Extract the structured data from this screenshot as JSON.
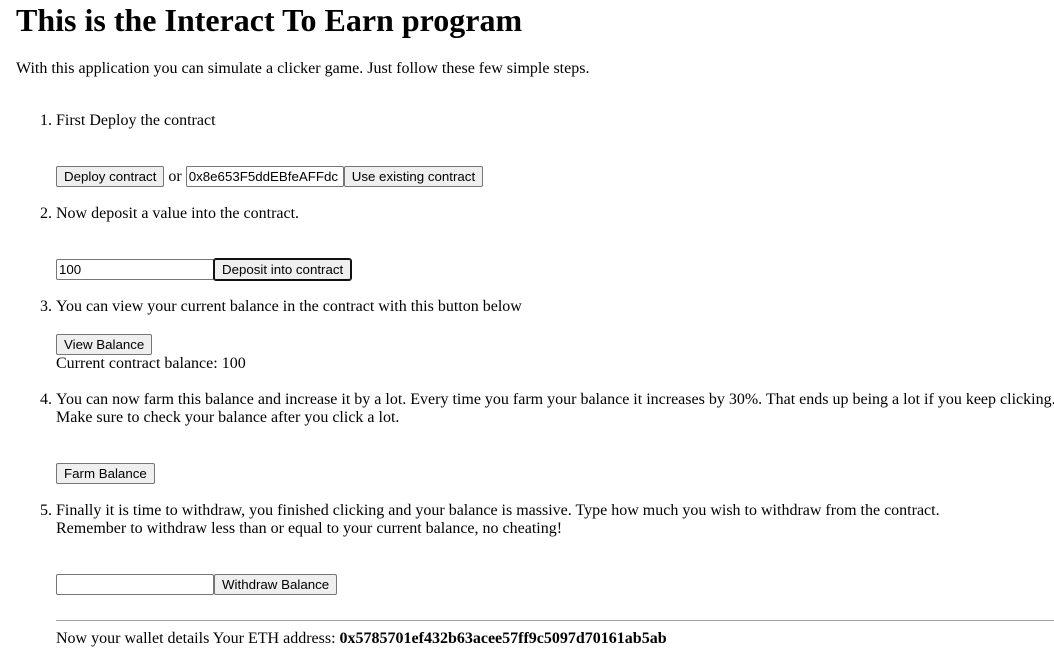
{
  "page": {
    "title": "This is the Interact To Earn program",
    "intro": "With this application you can simulate a clicker game. Just follow these few simple steps."
  },
  "steps": [
    {
      "number": "1.",
      "text": "First Deploy the contract"
    },
    {
      "number": "2.",
      "text": "Now deposit a value into the contract."
    },
    {
      "number": "3.",
      "text": "You can view your current balance in the contract with this button below"
    },
    {
      "number": "4.",
      "text": "You can now farm this balance and increase it by a lot. Every time you farm your balance it increases by 30%. That ends up being a lot if you keep clicking.",
      "text2": "Make sure to check your balance after you click a lot."
    },
    {
      "number": "5.",
      "text": "Finally it is time to withdraw, you finished clicking and your balance is massive. Type how much you wish to withdraw from the contract.",
      "text2": "Remember to withdraw less than or equal to your current balance, no cheating!"
    }
  ],
  "deploy": {
    "deploy_label": "Deploy contract",
    "or_text": "or",
    "address_value": "0x8e653F5ddEBfeAFFdc",
    "use_existing_label": "Use existing contract"
  },
  "deposit": {
    "amount_value": "100",
    "button_label": "Deposit into contract"
  },
  "balance": {
    "view_label": "View Balance",
    "current_text": "Current contract balance: 100"
  },
  "farm": {
    "button_label": "Farm Balance"
  },
  "withdraw": {
    "amount_value": "",
    "button_label": "Withdraw Balance"
  },
  "wallet": {
    "prefix": "Now your wallet details Your ETH address:",
    "address": "0x5785701ef432b63acee57ff9c5097d70161ab5ab"
  }
}
